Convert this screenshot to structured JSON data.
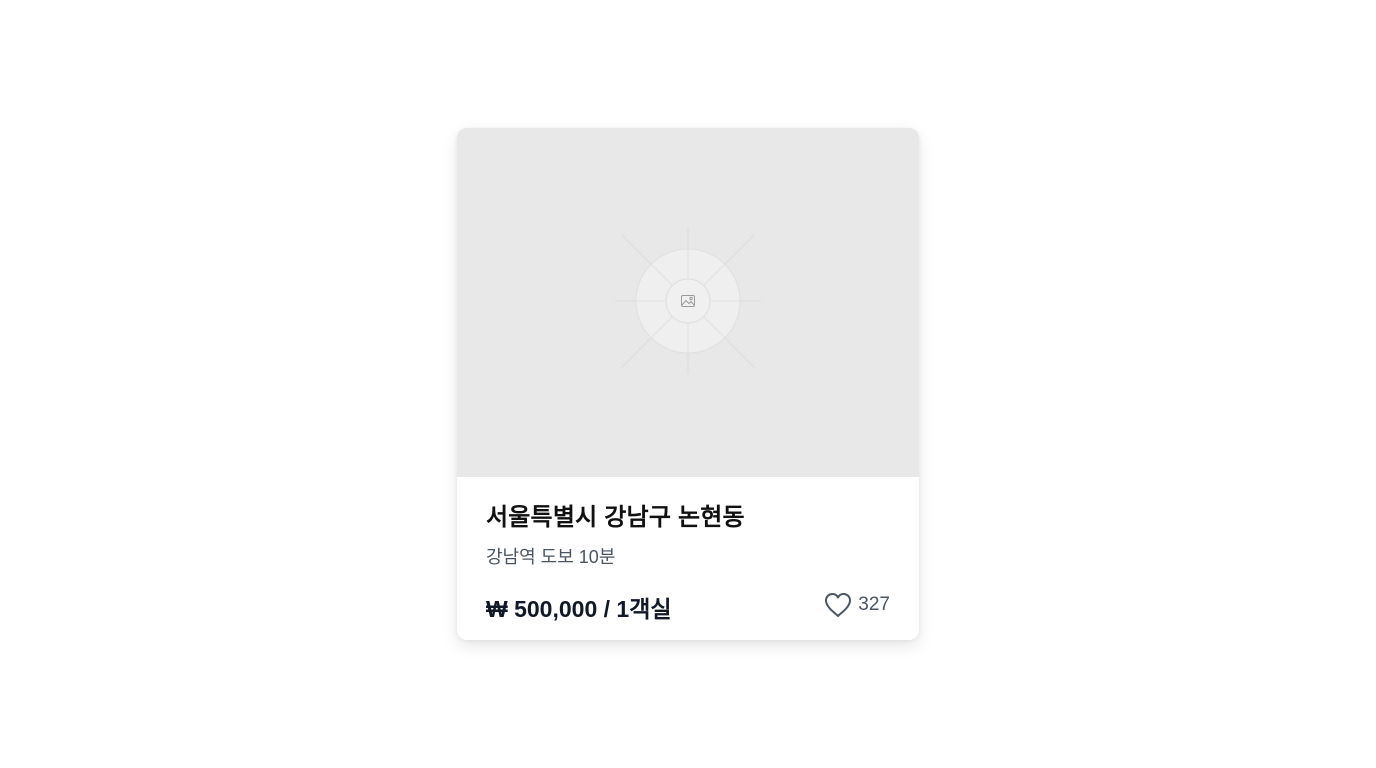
{
  "listing": {
    "image": {
      "icon": "image-placeholder-icon",
      "background": "#e8e8e8"
    },
    "title": "서울특별시 강남구 논현동",
    "subtitle": "강남역 도보 10분",
    "price": "₩ 500,000 / 1객실",
    "likes": {
      "icon": "heart-icon",
      "count": "327"
    }
  }
}
